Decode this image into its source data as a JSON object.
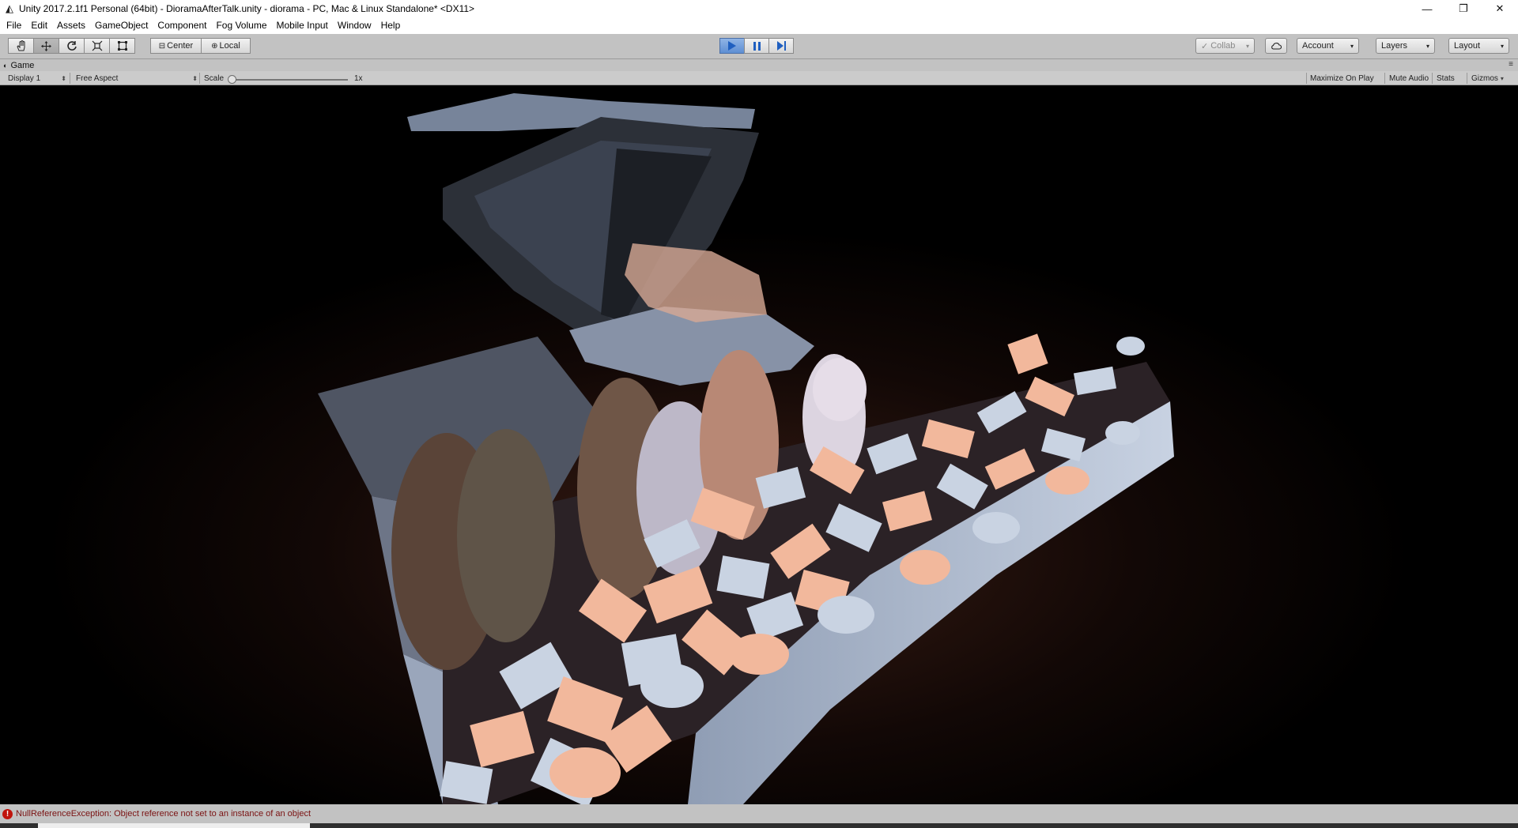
{
  "window": {
    "title": "Unity 2017.2.1f1 Personal (64bit) - DioramaAfterTalk.unity - diorama - PC, Mac & Linux Standalone* <DX11>",
    "minimize_glyph": "—",
    "restore_glyph": "❐",
    "close_glyph": "✕"
  },
  "menu": [
    "File",
    "Edit",
    "Assets",
    "GameObject",
    "Component",
    "Fog Volume",
    "Mobile Input",
    "Window",
    "Help"
  ],
  "toolbar": {
    "pivot_label": "Center",
    "space_label": "Local",
    "play_state": "playing",
    "collab_label": "Collab",
    "account_label": "Account",
    "layers_label": "Layers",
    "layout_label": "Layout"
  },
  "game_tab": {
    "title": "Game",
    "display": "Display 1",
    "aspect": "Free Aspect",
    "scale_label": "Scale",
    "scale_value": "1x",
    "scale_level": 0.0,
    "maximize_on_play": "Maximize On Play",
    "mute_audio": "Mute Audio",
    "stats": "Stats",
    "gizmos": "Gizmos"
  },
  "status": {
    "error_message": "NullReferenceException: Object reference not set to an instance of an object"
  },
  "colors": {
    "editor_bg": "#c2c2c2",
    "play_active": "#5e8fd3",
    "error_red": "#c0140c",
    "scene_salmon": "#f2b89c",
    "scene_blue_white": "#c9d3e2"
  }
}
